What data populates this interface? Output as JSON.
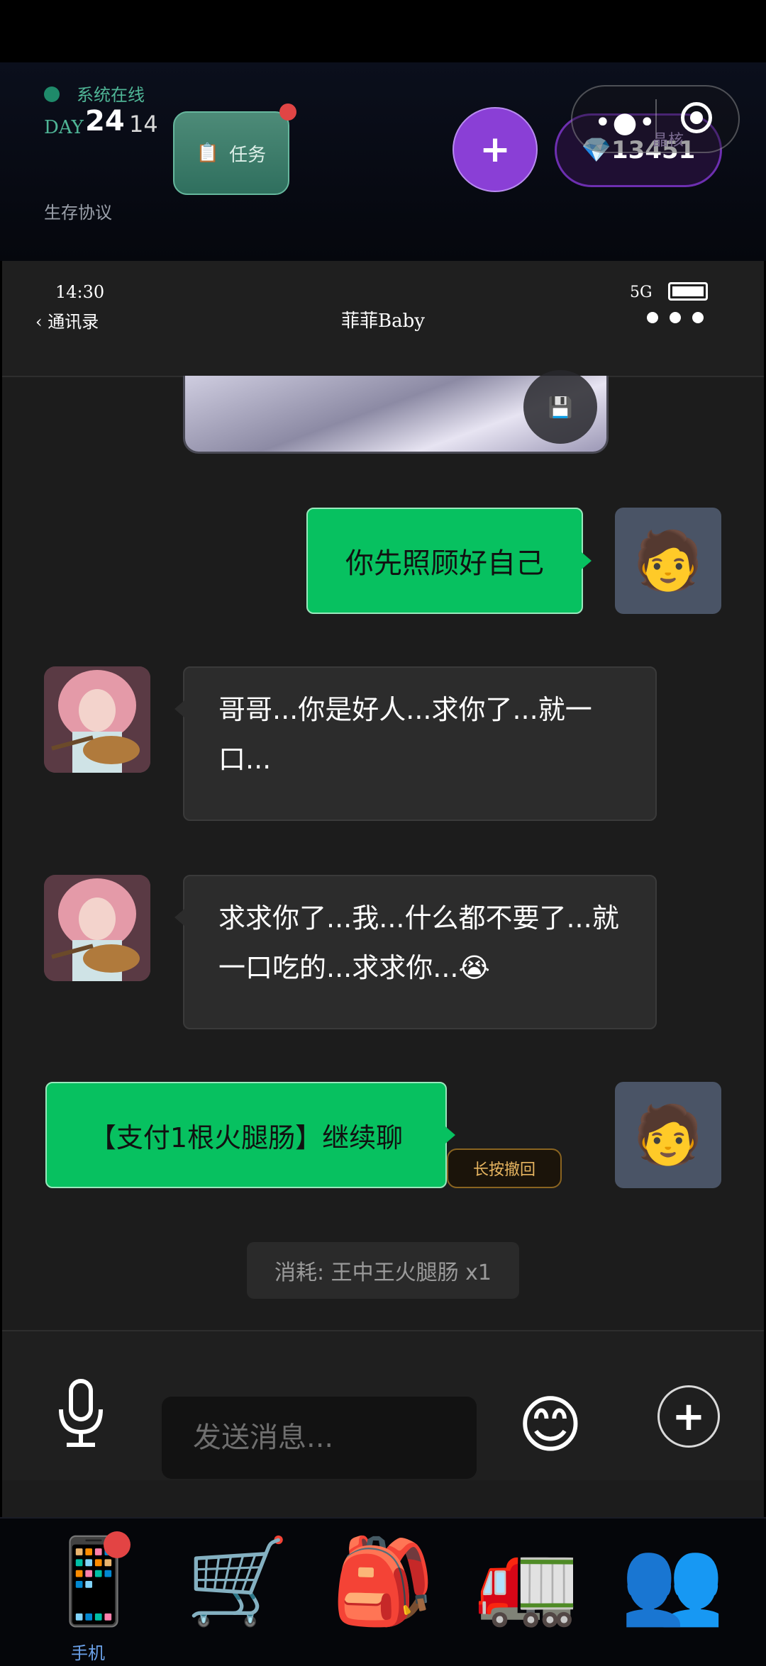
{
  "hud": {
    "online_status": "系统在线",
    "day_label": "DAY",
    "day_number": "24",
    "day_sub": "14",
    "protocol": "生存协议",
    "task_icon": "📋",
    "task_label": "任务",
    "plus_label": "+",
    "gems": "💎13451",
    "crystal_label": "晶核",
    "capsule_dots": "•●•"
  },
  "status_bar": {
    "time": "14:30",
    "network": "5G"
  },
  "chat_header": {
    "back_label": "‹ 通讯录",
    "title": "菲菲Baby"
  },
  "messages": {
    "save_icon": "💾",
    "m1_text": "你先照顾好自己",
    "m2_text": "哥哥...你是好人...求你了...就一口...",
    "m3_text": "求求你了...我...什么都不要了...就一口吃的...求求你...😭",
    "m4_text": "【支付1根火腿肠】继续聊",
    "undo_label": "长按撤回",
    "consume_text": "消耗: 王中王火腿肠 x1",
    "me_avatar": "🧑"
  },
  "input": {
    "placeholder": "发送消息...",
    "emoji": "😊",
    "plus": "+"
  },
  "dock": {
    "phone_icon": "📱",
    "cart_icon": "🛒",
    "bag_icon": "🎒",
    "truck_icon": "🚛",
    "people_icon": "👥",
    "phone_label": "手机"
  },
  "colors": {
    "bubble_out": "#07c160",
    "bubble_in": "#2c2c2c",
    "accent_purple": "#8a3fd6"
  }
}
